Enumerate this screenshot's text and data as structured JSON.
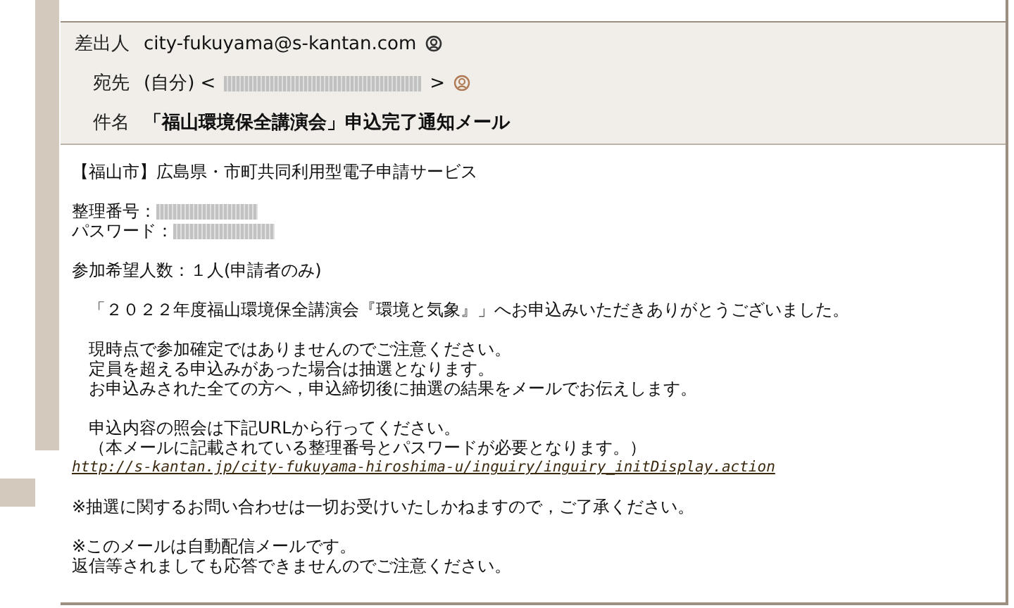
{
  "header": {
    "from": {
      "label": "差出人",
      "value": "city-fukuyama@s-kantan.com"
    },
    "to": {
      "label": "宛先",
      "value_prefix": "(自分) <",
      "value_suffix": ">",
      "redacted": true
    },
    "subject": {
      "label": "件名",
      "value": "「福山環境保全講演会」申込完了通知メール"
    }
  },
  "body": {
    "paragraphs": [
      [
        {
          "kind": "text",
          "text": "【福山市】広島県・市町共同利用型電子申請サービス"
        }
      ],
      [
        {
          "kind": "field",
          "text": "整理番号：",
          "redacted": true
        },
        {
          "kind": "field",
          "text": "パスワード：",
          "redacted": true
        }
      ],
      [
        {
          "kind": "text",
          "text": "参加希望人数：１人(申請者のみ)"
        }
      ],
      [
        {
          "kind": "text",
          "text": "　「２０２２年度福山環境保全講演会『環境と気象』」へお申込みいただきありがとうございました。"
        }
      ],
      [
        {
          "kind": "text",
          "text": "　現時点で参加確定ではありませんのでご注意ください。"
        },
        {
          "kind": "text",
          "text": "　定員を超える申込みがあった場合は抽選となります。"
        },
        {
          "kind": "text",
          "text": "　お申込みされた全ての方へ，申込締切後に抽選の結果をメールでお伝えします。"
        }
      ],
      [
        {
          "kind": "text",
          "text": "　申込内容の照会は下記URLから行ってください。"
        },
        {
          "kind": "text",
          "text": "　（本メールに記載されている整理番号とパスワードが必要となります。）"
        },
        {
          "kind": "link",
          "text": "http://s-kantan.jp/city-fukuyama-hiroshima-u/inguiry/inguiry_initDisplay.action"
        }
      ],
      [
        {
          "kind": "text",
          "text": "※抽選に関するお問い合わせは一切お受けいたしかねますので，ご了承ください。"
        }
      ],
      [
        {
          "kind": "text",
          "text": "※このメールは自動配信メールです。"
        },
        {
          "kind": "text",
          "text": "返信等されましても応答できませんのでご注意ください。"
        }
      ]
    ]
  }
}
